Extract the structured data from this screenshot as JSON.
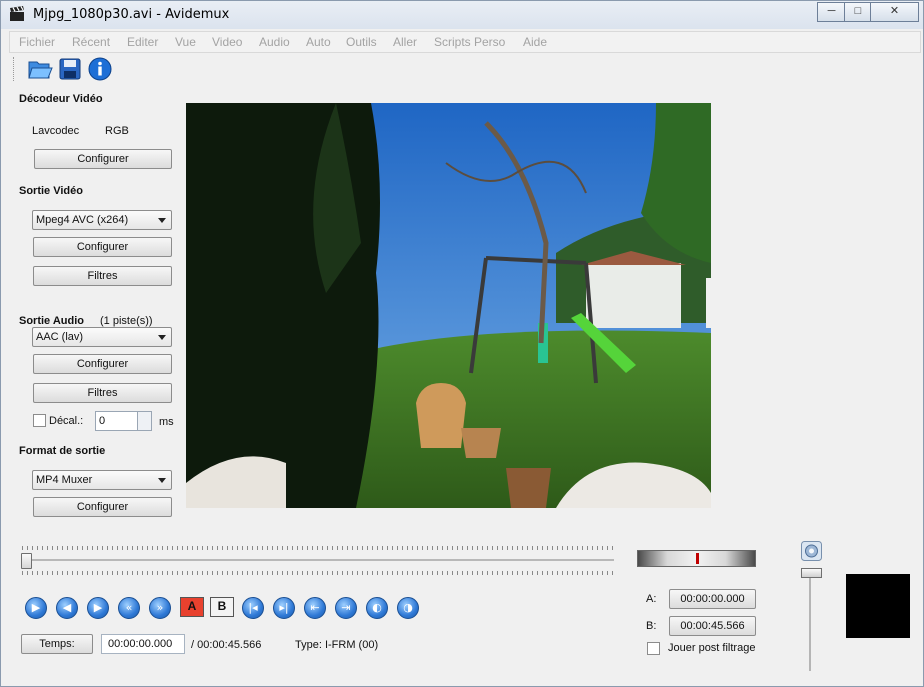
{
  "window": {
    "title": "Mjpg_1080p30.avi - Avidemux",
    "controls": {
      "minimize": "─",
      "maximize": "□",
      "close": "✕"
    }
  },
  "menu": [
    "Fichier",
    "Récent",
    "Editer",
    "Vue",
    "Video",
    "Audio",
    "Auto",
    "Outils",
    "Aller",
    "Scripts Perso",
    "Aide"
  ],
  "toolbar": {
    "icons": [
      "open-file-icon",
      "save-icon",
      "info-icon"
    ]
  },
  "video_decoder": {
    "title": "Décodeur Vidéo",
    "codec": "Lavcodec",
    "format": "RGB",
    "configure_label": "Configurer"
  },
  "video_output": {
    "title": "Sortie Vidéo",
    "selected": "Mpeg4 AVC (x264)",
    "configure_label": "Configurer",
    "filters_label": "Filtres"
  },
  "audio_output": {
    "title": "Sortie Audio",
    "tracks": "(1 piste(s))",
    "selected": "AAC (lav)",
    "configure_label": "Configurer",
    "filters_label": "Filtres",
    "shift_label": "Décal.:",
    "shift_value": "0",
    "shift_unit": "ms"
  },
  "output_format": {
    "title": "Format de sortie",
    "selected": "MP4 Muxer",
    "configure_label": "Configurer"
  },
  "playback": {
    "position_fraction": 0.0,
    "nav_icons": [
      "play-icon",
      "prev-frame-icon",
      "next-frame-icon",
      "rewind-icon",
      "fast-forward-icon"
    ],
    "marker_a": "A",
    "marker_b": "B"
  },
  "status": {
    "time_button": "Temps:",
    "current_time": "00:00:00.000",
    "total_time": "/ 00:00:45.566",
    "frame_type": "Type:  I-FRM (00)"
  },
  "selection": {
    "a_label": "A:",
    "a_time": "00:00:00.000",
    "b_label": "B:",
    "b_time": "00:00:45.566",
    "post_filter_label": "Jouer post filtrage"
  },
  "colors": {
    "accent_blue": "#2f79d6",
    "marker_red": "#e8412e"
  }
}
